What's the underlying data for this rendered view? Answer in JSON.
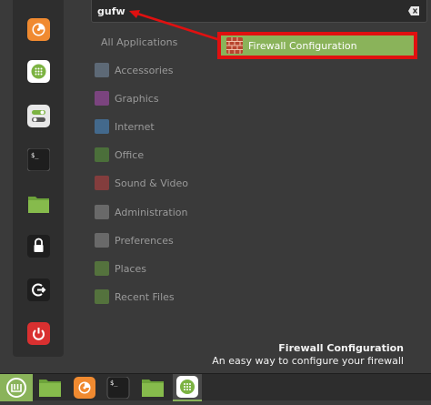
{
  "search": {
    "value": "gufw",
    "placeholder": ""
  },
  "categories": {
    "all": "All Applications",
    "items": [
      {
        "label": "Accessories",
        "icon": "accessories-icon",
        "color": "#7a8fa8"
      },
      {
        "label": "Graphics",
        "icon": "graphics-icon",
        "color": "#b04db8"
      },
      {
        "label": "Internet",
        "icon": "internet-icon",
        "color": "#4a8fd0"
      },
      {
        "label": "Office",
        "icon": "office-icon",
        "color": "#5a9a3a"
      },
      {
        "label": "Sound & Video",
        "icon": "sound-video-icon",
        "color": "#c04040"
      },
      {
        "label": "Administration",
        "icon": "administration-icon",
        "color": "#909090"
      },
      {
        "label": "Preferences",
        "icon": "preferences-icon",
        "color": "#909090"
      },
      {
        "label": "Places",
        "icon": "places-icon",
        "color": "#6aa040"
      },
      {
        "label": "Recent Files",
        "icon": "recent-files-icon",
        "color": "#6aa040"
      }
    ]
  },
  "result": {
    "label": "Firewall Configuration",
    "icon": "firewall-icon"
  },
  "description": {
    "title": "Firewall Configuration",
    "text": "An easy way to configure your firewall"
  },
  "favorites": [
    {
      "name": "firefox-icon"
    },
    {
      "name": "software-manager-icon"
    },
    {
      "name": "system-settings-icon"
    },
    {
      "name": "terminal-icon"
    },
    {
      "name": "files-icon"
    },
    {
      "name": "lock-screen-icon"
    },
    {
      "name": "logout-icon"
    },
    {
      "name": "power-icon"
    }
  ],
  "taskbar": [
    {
      "name": "menu-icon"
    },
    {
      "name": "show-desktop-icon"
    },
    {
      "name": "firefox-icon"
    },
    {
      "name": "terminal-icon"
    },
    {
      "name": "files-icon"
    },
    {
      "name": "software-manager-icon"
    }
  ],
  "colors": {
    "accent": "#8ab35a",
    "highlight_border": "#e01010"
  }
}
